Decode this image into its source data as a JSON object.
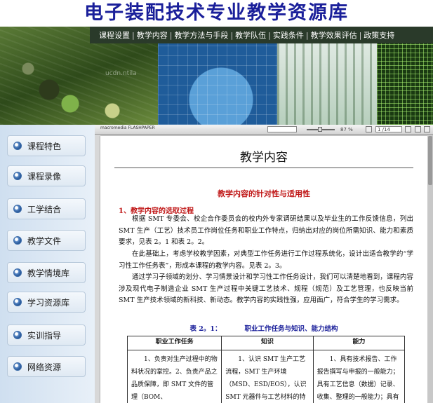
{
  "site": {
    "title": "电子装配技术专业教学资源库"
  },
  "nav": {
    "items": [
      "课程设置",
      "教学内容",
      "教学方法与手段",
      "教学队伍",
      "实践条件",
      "教学效果评估",
      "政策支持"
    ],
    "separator": "|"
  },
  "banner": {
    "watermark": "ucdn.ntila"
  },
  "sidebar": {
    "items": [
      "课程特色",
      "课程录像",
      "工学结合",
      "教学文件",
      "教学情境库",
      "学习资源库",
      "实训指导",
      "网络资源"
    ]
  },
  "viewer": {
    "brand": "macromedia FLASHPAPER",
    "zoom": "87 %",
    "page": "1 /14"
  },
  "document": {
    "title": "教学内容",
    "subtitle": "教学内容的针对性与适用性",
    "section1": "1、教学内容的选取过程",
    "para1": "根据 SMT 专委会、校企合作委员会的校内外专家调研结果以及毕业生的工作反馈信息，列出 SMT 生产（工艺）技术员工作岗位任务和职业工作特点，归纳出对应的岗位所需知识、能力和素质要求，见表 2。1 和表 2。2。",
    "para2": "在此基础上，考虑学校教学因素，对典型工作任务进行工作过程系统化，设计出适合教学的“学习性工作任务表”，形成本课程的教学内容。见表 2。3。",
    "para3": "通过学习子领域的划分、学习情景设计和学习性工作任务设计，我们可以清楚地看到，课程内容涉及现代电子制造企业 SMT 生产过程中关键工艺技术、规程（规范）及工艺管理，也反映当前 SMT 生产技术领域的新科技、新动态。教学内容的实践性强，应用面广，符合学生的学习需求。",
    "table_caption_num": "表 2。1：",
    "table_caption_title": "职业工作任务与知识、能力结构",
    "table": {
      "headers": [
        "职业工作任务",
        "知识",
        "能力"
      ],
      "row1": [
        "1、负责对生产过程中的物料状况的掌控。2、负责产品之品质保障，即 SMT 文件的管理（BOM、",
        "1、认识 SMT 生产工艺流程，SMT 生产环境（MSD、ESD/EOS），认识 SMT 元器件与工艺材料的特性和 PCB 板的可",
        "1、具有技术报告、工作报告撰写与申报的一般能力；具有工艺信息（数据）记录、收集、整理的一般能力；具有组"
      ]
    }
  }
}
